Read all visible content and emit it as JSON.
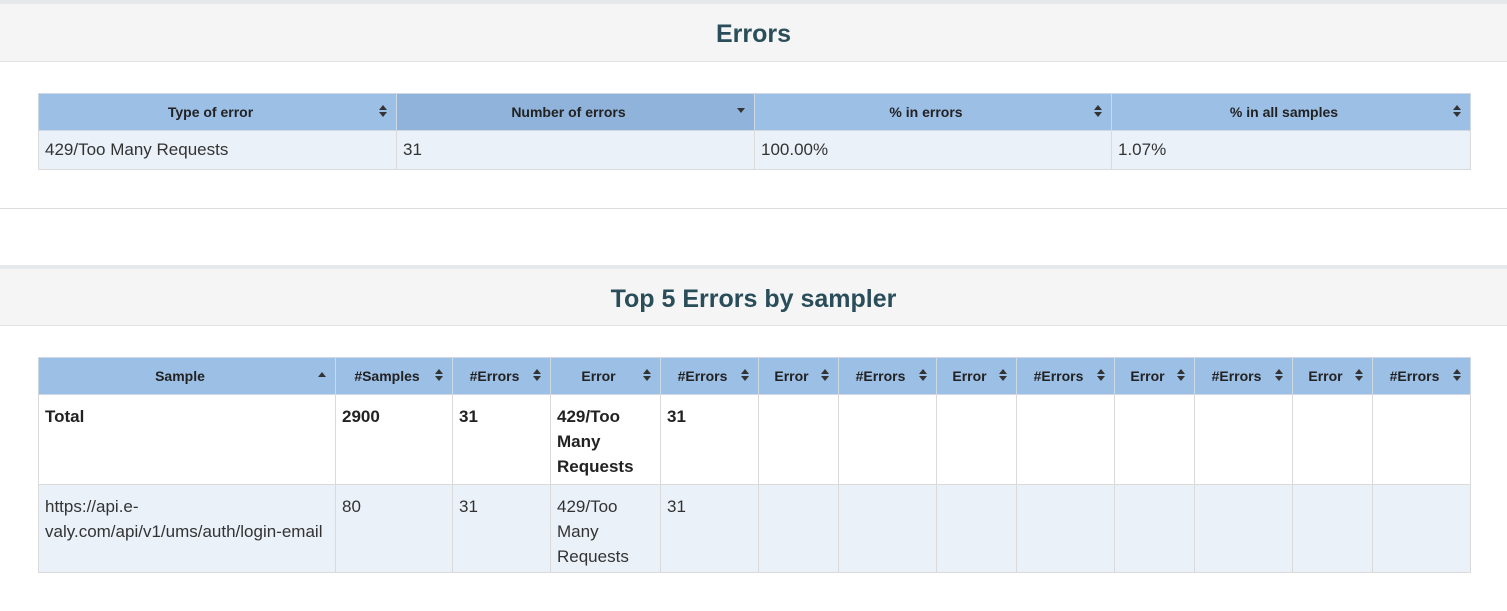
{
  "errors_panel": {
    "title": "Errors",
    "headers": [
      "Type of error",
      "Number of errors",
      "% in errors",
      "% in all samples"
    ],
    "sort_state": [
      "both",
      "down",
      "both",
      "both"
    ],
    "rows": [
      [
        "429/Too Many Requests",
        "31",
        "100.00%",
        "1.07%"
      ]
    ]
  },
  "top5_panel": {
    "title": "Top 5 Errors by sampler",
    "headers": [
      "Sample",
      "#Samples",
      "#Errors",
      "Error",
      "#Errors",
      "Error",
      "#Errors",
      "Error",
      "#Errors",
      "Error",
      "#Errors",
      "Error",
      "#Errors"
    ],
    "sort_state": [
      "up",
      "both",
      "both",
      "both",
      "both",
      "both",
      "both",
      "both",
      "both",
      "both",
      "both",
      "both",
      "both"
    ],
    "rows": [
      [
        "Total",
        "2900",
        "31",
        "429/Too Many Requests",
        "31",
        "",
        "",
        "",
        "",
        "",
        "",
        "",
        ""
      ],
      [
        "https://api.e-valy.com/api/v1/ums/auth/login-email",
        "80",
        "31",
        "429/Too Many Requests",
        "31",
        "",
        "",
        "",
        "",
        "",
        "",
        "",
        ""
      ]
    ]
  },
  "colors": {
    "header_bg": "#9cbfe6",
    "header_sorted_bg": "#8fb3da",
    "row_alt_bg": "#eaf1f9",
    "title_color": "#2a4d5a",
    "panel_heading_bg": "#f5f5f5"
  }
}
